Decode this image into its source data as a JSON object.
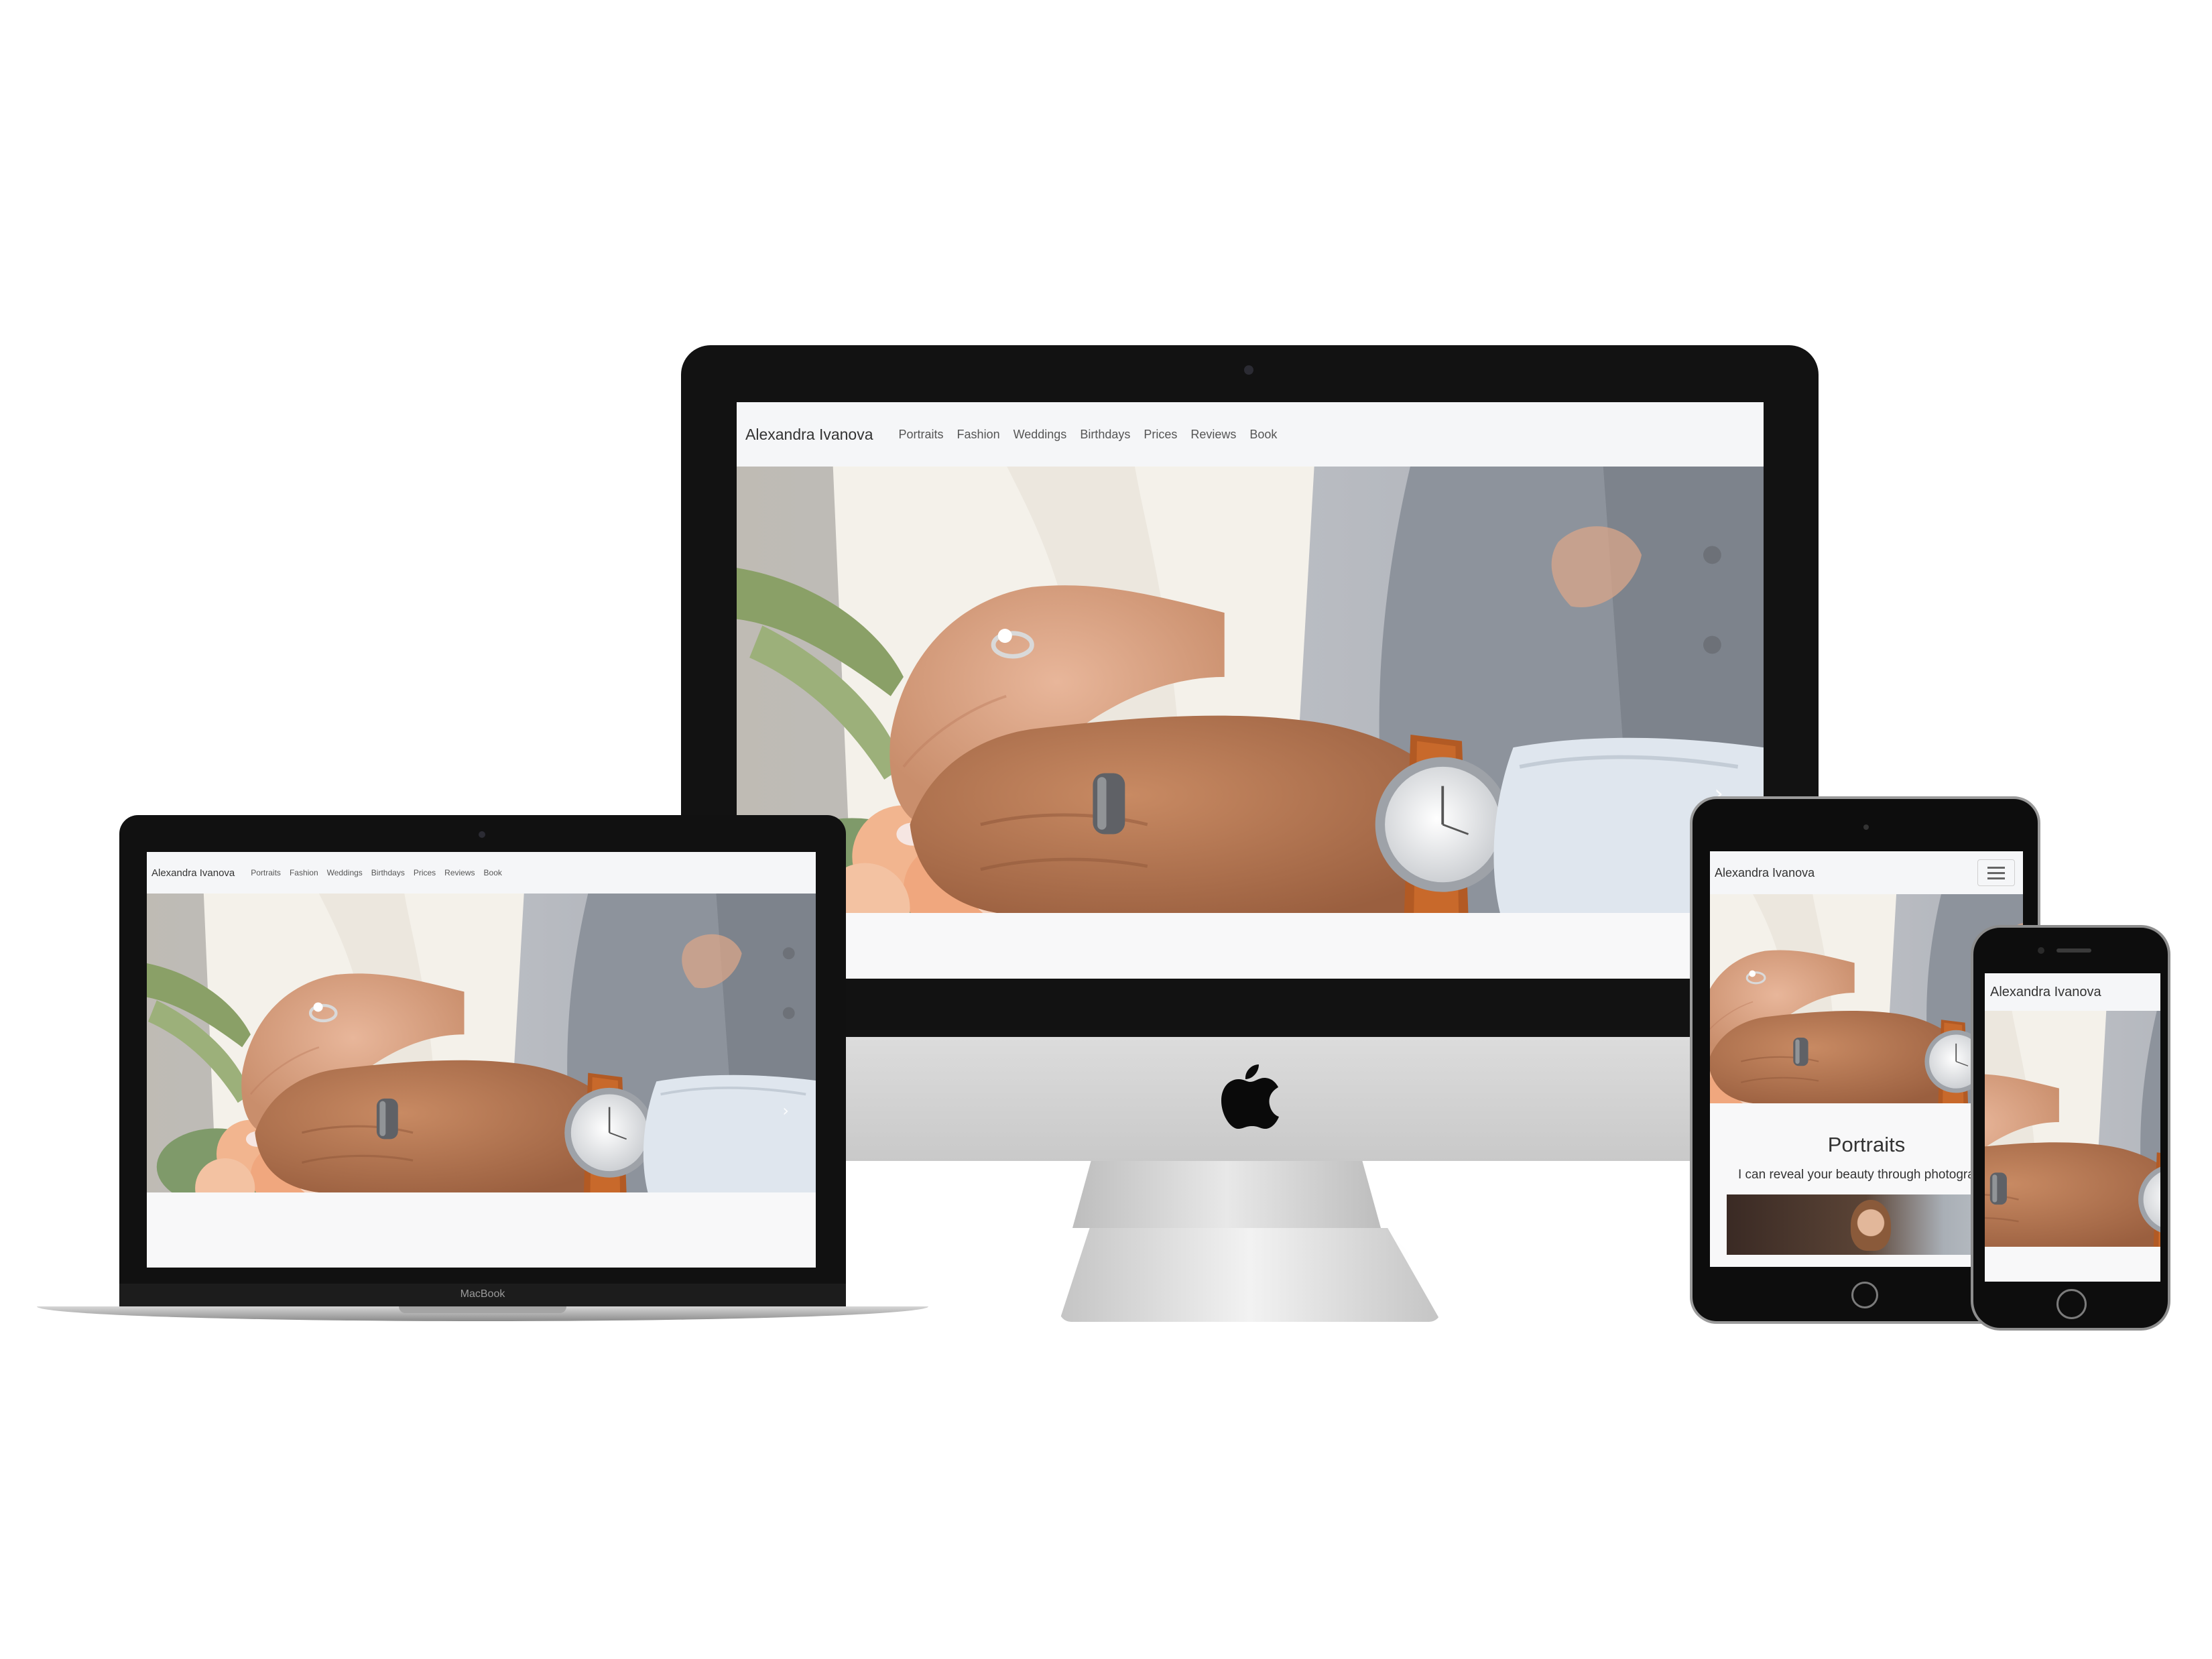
{
  "site": {
    "brand": "Alexandra Ivanova",
    "nav": [
      "Portraits",
      "Fashion",
      "Weddings",
      "Birthdays",
      "Prices",
      "Reviews",
      "Book"
    ]
  },
  "ipad": {
    "section_title": "Portraits",
    "section_text": "I can reveal your beauty through photograp"
  },
  "macbook": {
    "label": "MacBook"
  },
  "icons": {
    "next": "chevron-right-icon",
    "menu": "hamburger-menu-icon",
    "brand_logo": "apple-logo-icon"
  },
  "colors": {
    "nav_bg": "#f5f6f8",
    "device_black": "#121212",
    "page_bg": "#ffffff"
  }
}
